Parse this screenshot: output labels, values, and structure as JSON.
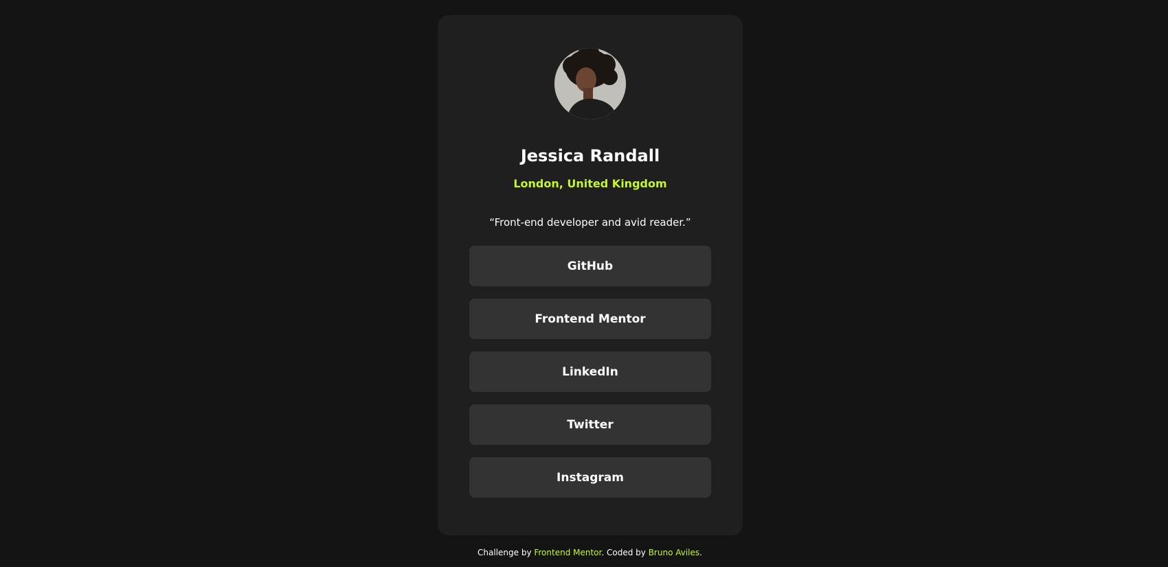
{
  "profile": {
    "name": "Jessica Randall",
    "location": "London, United Kingdom",
    "bio": "“Front-end developer and avid reader.”"
  },
  "links": [
    {
      "label": "GitHub"
    },
    {
      "label": "Frontend Mentor"
    },
    {
      "label": "LinkedIn"
    },
    {
      "label": "Twitter"
    },
    {
      "label": "Instagram"
    }
  ],
  "footer": {
    "prefix": "Challenge by ",
    "challenge_link": "Frontend Mentor",
    "middle": ". Coded by ",
    "author_link": "Bruno Aviles",
    "suffix": "."
  },
  "colors": {
    "background": "#141414",
    "card": "#1f1f1f",
    "button": "#333333",
    "accent": "#c4f82a",
    "text": "#ffffff"
  }
}
